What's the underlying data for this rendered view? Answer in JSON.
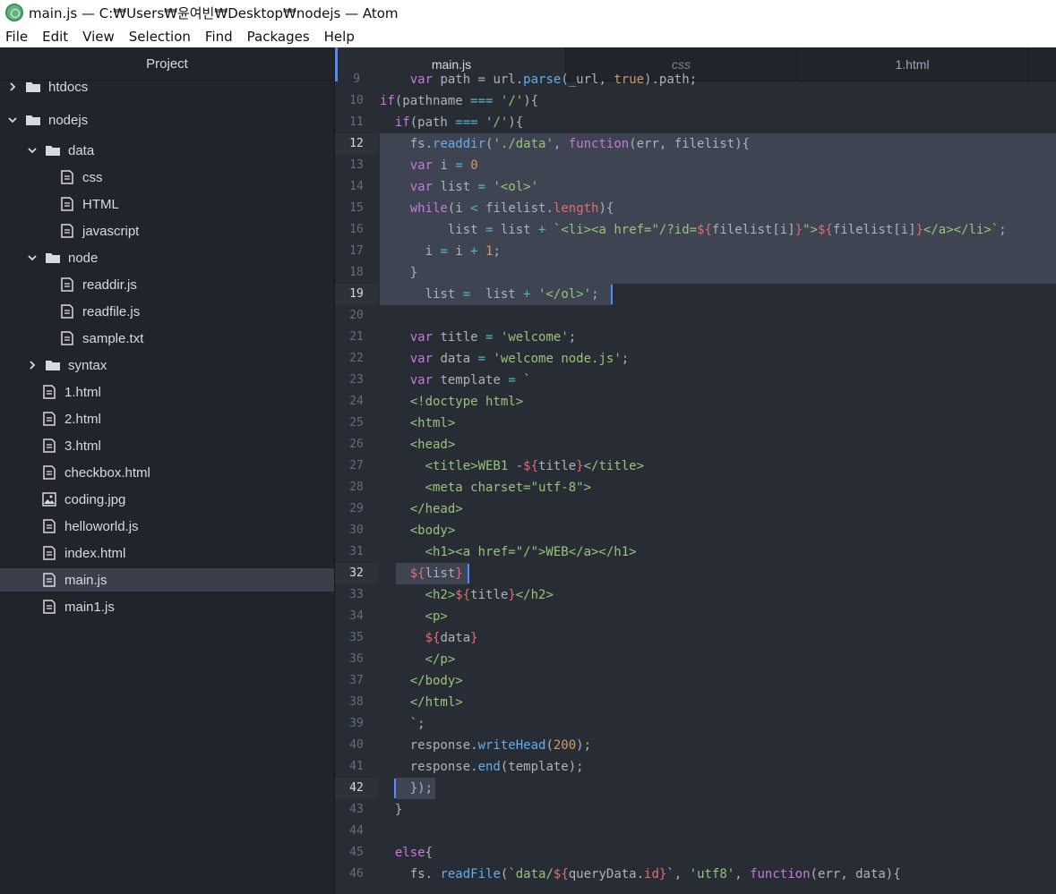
{
  "window": {
    "title": "main.js — C:₩Users₩윤여빈₩Desktop₩nodejs — Atom"
  },
  "menu": [
    "File",
    "Edit",
    "View",
    "Selection",
    "Find",
    "Packages",
    "Help"
  ],
  "sidebar": {
    "header": "Project",
    "tree": [
      {
        "label": "htdocs",
        "type": "folder",
        "open": false,
        "depth": 0
      },
      {
        "label": "nodejs",
        "type": "folder",
        "open": true,
        "depth": 0
      },
      {
        "label": "data",
        "type": "folder",
        "open": true,
        "depth": 1
      },
      {
        "label": "css",
        "type": "file",
        "depth": 2
      },
      {
        "label": "HTML",
        "type": "file",
        "depth": 2
      },
      {
        "label": "javascript",
        "type": "file",
        "depth": 2
      },
      {
        "label": "node",
        "type": "folder",
        "open": true,
        "depth": 1
      },
      {
        "label": "readdir.js",
        "type": "file",
        "depth": 2
      },
      {
        "label": "readfile.js",
        "type": "file",
        "depth": 2
      },
      {
        "label": "sample.txt",
        "type": "file",
        "depth": 2
      },
      {
        "label": "syntax",
        "type": "folder",
        "open": false,
        "depth": 1
      },
      {
        "label": "1.html",
        "type": "file",
        "depth": 1
      },
      {
        "label": "2.html",
        "type": "file",
        "depth": 1
      },
      {
        "label": "3.html",
        "type": "file",
        "depth": 1
      },
      {
        "label": "checkbox.html",
        "type": "file",
        "depth": 1
      },
      {
        "label": "coding.jpg",
        "type": "image",
        "depth": 1
      },
      {
        "label": "helloworld.js",
        "type": "file",
        "depth": 1
      },
      {
        "label": "index.html",
        "type": "file",
        "depth": 1
      },
      {
        "label": "main.js",
        "type": "file",
        "depth": 1,
        "selected": true
      },
      {
        "label": "main1.js",
        "type": "file",
        "depth": 1
      }
    ]
  },
  "tabs": [
    {
      "label": "main.js",
      "active": true
    },
    {
      "label": "css",
      "active": false
    },
    {
      "label": "1.html",
      "active": false
    }
  ],
  "code": {
    "lines": [
      {
        "n": "9",
        "t": [
          [
            "    ",
            "plain"
          ],
          [
            "var",
            "kw"
          ],
          [
            " path = url.",
            "plain"
          ],
          [
            "parse",
            "fn"
          ],
          [
            "(_url, ",
            "plain"
          ],
          [
            "true",
            "num"
          ],
          [
            ").path;",
            "plain"
          ]
        ]
      },
      {
        "n": "10",
        "t": [
          [
            "if",
            "kw"
          ],
          [
            "(pathname ",
            "plain"
          ],
          [
            "===",
            "op"
          ],
          [
            " ",
            "plain"
          ],
          [
            "'/'",
            "str"
          ],
          [
            "){",
            "plain"
          ]
        ]
      },
      {
        "n": "11",
        "t": [
          [
            "  ",
            "plain"
          ],
          [
            "if",
            "kw"
          ],
          [
            "(path ",
            "plain"
          ],
          [
            "===",
            "op"
          ],
          [
            " ",
            "plain"
          ],
          [
            "'/'",
            "str"
          ],
          [
            "){",
            "plain"
          ]
        ]
      },
      {
        "n": "12",
        "t": [
          [
            "    fs.",
            "plain"
          ],
          [
            "readdir",
            "fn"
          ],
          [
            "(",
            "plain"
          ],
          [
            "'./data'",
            "str"
          ],
          [
            ", ",
            "plain"
          ],
          [
            "function",
            "kw"
          ],
          [
            "(err, filelist){",
            "plain"
          ]
        ]
      },
      {
        "n": "13",
        "t": [
          [
            "    ",
            "plain"
          ],
          [
            "var",
            "kw"
          ],
          [
            " i ",
            "plain"
          ],
          [
            "=",
            "op"
          ],
          [
            " ",
            "plain"
          ],
          [
            "0",
            "num"
          ]
        ]
      },
      {
        "n": "14",
        "t": [
          [
            "    ",
            "plain"
          ],
          [
            "var",
            "kw"
          ],
          [
            " list ",
            "plain"
          ],
          [
            "=",
            "op"
          ],
          [
            " ",
            "plain"
          ],
          [
            "'<ol>'",
            "str"
          ]
        ]
      },
      {
        "n": "15",
        "t": [
          [
            "    ",
            "plain"
          ],
          [
            "while",
            "kw"
          ],
          [
            "(i ",
            "plain"
          ],
          [
            "<",
            "op"
          ],
          [
            " filelist.",
            "plain"
          ],
          [
            "length",
            "interp"
          ],
          [
            "){",
            "plain"
          ]
        ]
      },
      {
        "n": "16",
        "t": [
          [
            "         list ",
            "plain"
          ],
          [
            "=",
            "op"
          ],
          [
            " list ",
            "plain"
          ],
          [
            "+",
            "op"
          ],
          [
            " ",
            "plain"
          ],
          [
            "`<li><a href=\"/?id=",
            "str"
          ],
          [
            "${",
            "interp"
          ],
          [
            "filelist[i]",
            "plain"
          ],
          [
            "}",
            "interp"
          ],
          [
            "\">",
            "str"
          ],
          [
            "${",
            "interp"
          ],
          [
            "filelist[i]",
            "plain"
          ],
          [
            "}",
            "interp"
          ],
          [
            "</a></li>`",
            "str"
          ],
          [
            ";",
            "plain"
          ]
        ]
      },
      {
        "n": "17",
        "t": [
          [
            "      i ",
            "plain"
          ],
          [
            "=",
            "op"
          ],
          [
            " i ",
            "plain"
          ],
          [
            "+",
            "op"
          ],
          [
            " ",
            "plain"
          ],
          [
            "1",
            "num"
          ],
          [
            ";",
            "plain"
          ]
        ]
      },
      {
        "n": "18",
        "t": [
          [
            "    }",
            "plain"
          ]
        ]
      },
      {
        "n": "19",
        "t": [
          [
            "      list ",
            "plain"
          ],
          [
            "=",
            "op"
          ],
          [
            "  list ",
            "plain"
          ],
          [
            "+",
            "op"
          ],
          [
            " ",
            "plain"
          ],
          [
            "'</ol>'",
            "str"
          ],
          [
            ";",
            "plain"
          ]
        ]
      },
      {
        "n": "20",
        "t": [
          [
            "",
            "plain"
          ]
        ]
      },
      {
        "n": "21",
        "t": [
          [
            "    ",
            "plain"
          ],
          [
            "var",
            "kw"
          ],
          [
            " title ",
            "plain"
          ],
          [
            "=",
            "op"
          ],
          [
            " ",
            "plain"
          ],
          [
            "'welcome'",
            "str"
          ],
          [
            ";",
            "plain"
          ]
        ]
      },
      {
        "n": "22",
        "t": [
          [
            "    ",
            "plain"
          ],
          [
            "var",
            "kw"
          ],
          [
            " data ",
            "plain"
          ],
          [
            "=",
            "op"
          ],
          [
            " ",
            "plain"
          ],
          [
            "'welcome node.js'",
            "str"
          ],
          [
            ";",
            "plain"
          ]
        ]
      },
      {
        "n": "23",
        "t": [
          [
            "    ",
            "plain"
          ],
          [
            "var",
            "kw"
          ],
          [
            " template ",
            "plain"
          ],
          [
            "=",
            "op"
          ],
          [
            " ",
            "plain"
          ],
          [
            "`",
            "str"
          ]
        ]
      },
      {
        "n": "24",
        "t": [
          [
            "    <!doctype html>",
            "str"
          ]
        ]
      },
      {
        "n": "25",
        "t": [
          [
            "    <html>",
            "str"
          ]
        ]
      },
      {
        "n": "26",
        "t": [
          [
            "    <head>",
            "str"
          ]
        ]
      },
      {
        "n": "27",
        "t": [
          [
            "      <title>WEB1 -",
            "str"
          ],
          [
            "${",
            "interp"
          ],
          [
            "title",
            "plain"
          ],
          [
            "}",
            "interp"
          ],
          [
            "</title>",
            "str"
          ]
        ]
      },
      {
        "n": "28",
        "t": [
          [
            "      <meta charset=\"utf-8\">",
            "str"
          ]
        ]
      },
      {
        "n": "29",
        "t": [
          [
            "    </head>",
            "str"
          ]
        ]
      },
      {
        "n": "30",
        "t": [
          [
            "    <body>",
            "str"
          ]
        ]
      },
      {
        "n": "31",
        "t": [
          [
            "      <h1><a href=\"/\">WEB</a></h1>",
            "str"
          ]
        ]
      },
      {
        "n": "32",
        "t": [
          [
            "    ",
            "plain"
          ],
          [
            "${",
            "interp"
          ],
          [
            "list",
            "plain"
          ],
          [
            "}",
            "interp"
          ]
        ]
      },
      {
        "n": "33",
        "t": [
          [
            "      <h2>",
            "str"
          ],
          [
            "${",
            "interp"
          ],
          [
            "title",
            "plain"
          ],
          [
            "}",
            "interp"
          ],
          [
            "</h2>",
            "str"
          ]
        ]
      },
      {
        "n": "34",
        "t": [
          [
            "      <p>",
            "str"
          ]
        ]
      },
      {
        "n": "35",
        "t": [
          [
            "      ",
            "plain"
          ],
          [
            "${",
            "interp"
          ],
          [
            "data",
            "plain"
          ],
          [
            "}",
            "interp"
          ]
        ]
      },
      {
        "n": "36",
        "t": [
          [
            "      </p>",
            "str"
          ]
        ]
      },
      {
        "n": "37",
        "t": [
          [
            "    </body>",
            "str"
          ]
        ]
      },
      {
        "n": "38",
        "t": [
          [
            "    </html>",
            "str"
          ]
        ]
      },
      {
        "n": "39",
        "t": [
          [
            "    `",
            "str"
          ],
          [
            ";",
            "plain"
          ]
        ]
      },
      {
        "n": "40",
        "t": [
          [
            "    response.",
            "plain"
          ],
          [
            "writeHead",
            "fn"
          ],
          [
            "(",
            "plain"
          ],
          [
            "200",
            "num"
          ],
          [
            ");",
            "plain"
          ]
        ]
      },
      {
        "n": "41",
        "t": [
          [
            "    response.",
            "plain"
          ],
          [
            "end",
            "fn"
          ],
          [
            "(template);",
            "plain"
          ]
        ]
      },
      {
        "n": "42",
        "t": [
          [
            "    });",
            "plain"
          ]
        ]
      },
      {
        "n": "43",
        "t": [
          [
            "  }",
            "plain"
          ]
        ]
      },
      {
        "n": "44",
        "t": [
          [
            "",
            "plain"
          ]
        ]
      },
      {
        "n": "45",
        "t": [
          [
            "  ",
            "plain"
          ],
          [
            "else",
            "kw"
          ],
          [
            "{",
            "plain"
          ]
        ]
      },
      {
        "n": "46",
        "t": [
          [
            "    fs. ",
            "plain"
          ],
          [
            "readFile",
            "fn"
          ],
          [
            "(",
            "plain"
          ],
          [
            "`data/",
            "str"
          ],
          [
            "${",
            "interp"
          ],
          [
            "queryData.",
            "plain"
          ],
          [
            "id",
            "interp"
          ],
          [
            "}",
            "interp"
          ],
          [
            "`",
            "str"
          ],
          [
            ", ",
            "plain"
          ],
          [
            "'utf8'",
            "str"
          ],
          [
            ", ",
            "plain"
          ],
          [
            "function",
            "kw"
          ],
          [
            "(err, data){",
            "plain"
          ]
        ]
      }
    ]
  }
}
